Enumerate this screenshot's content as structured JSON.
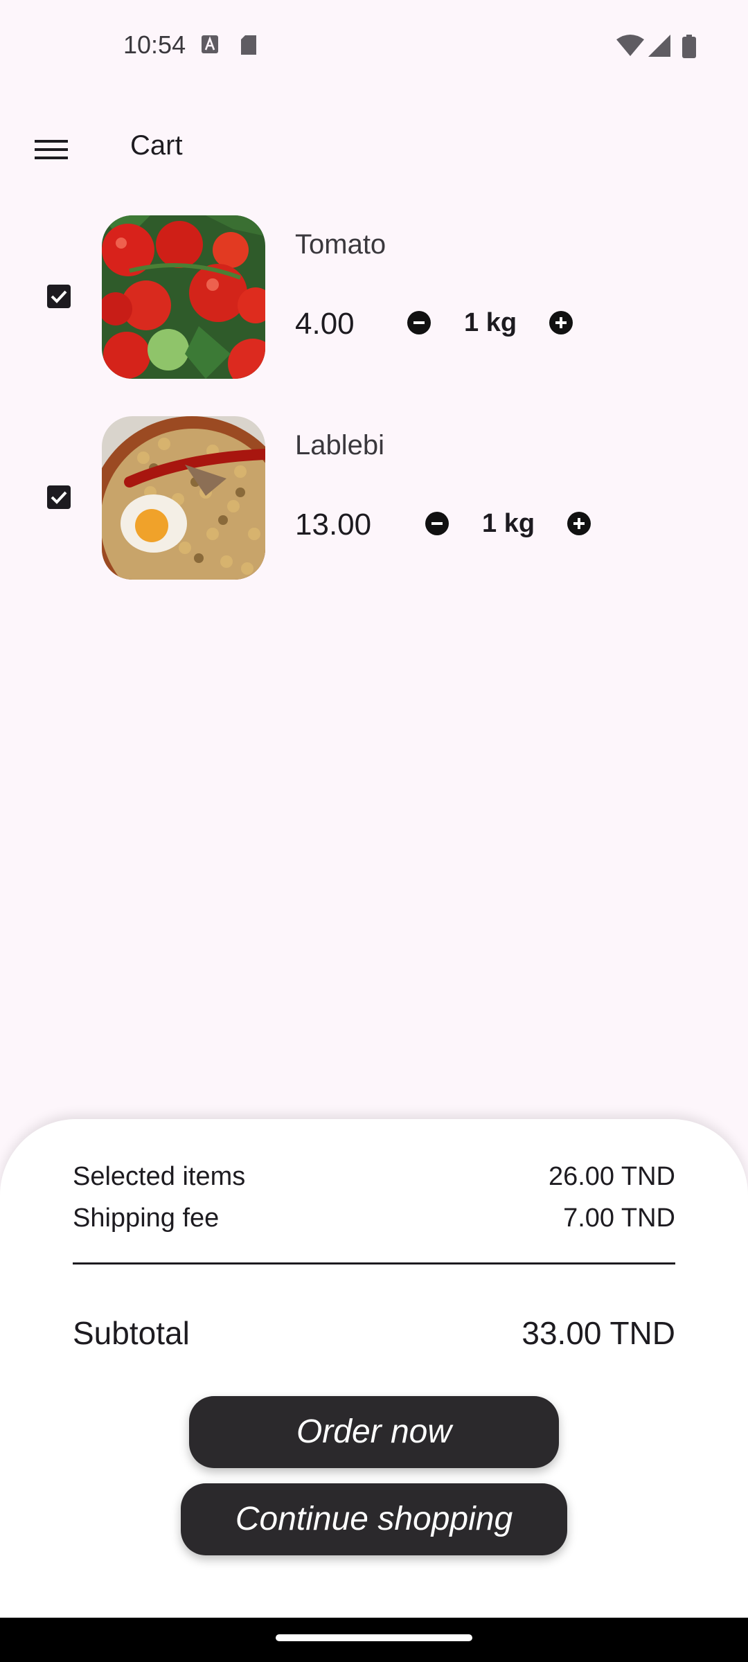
{
  "status_bar": {
    "time": "10:54",
    "left_icons": [
      "keyboard-a-icon",
      "sd-card-icon"
    ],
    "right_icons": [
      "wifi-icon",
      "cellular-signal-icon",
      "battery-icon"
    ]
  },
  "app_bar": {
    "menu_icon": "hamburger-menu-icon",
    "title": "Cart"
  },
  "cart": {
    "items": [
      {
        "name": "Tomato",
        "price": "4.00",
        "quantity": "1 kg",
        "checked": true,
        "image": "tomatoes-photo"
      },
      {
        "name": "Lablebi",
        "price": "13.00",
        "quantity": "1 kg",
        "checked": true,
        "image": "lablebi-dish-photo"
      }
    ]
  },
  "summary": {
    "selected_items_label": "Selected items",
    "selected_items_value": "26.00 TND",
    "shipping_fee_label": "Shipping fee",
    "shipping_fee_value": "7.00 TND",
    "subtotal_label": "Subtotal",
    "subtotal_value": "33.00 TND"
  },
  "actions": {
    "order_now": "Order now",
    "continue_shopping": "Continue shopping"
  },
  "colors": {
    "background": "#fdf6fb",
    "sheet": "#ffffff",
    "button": "#2b292c",
    "text": "#1d1b20"
  }
}
